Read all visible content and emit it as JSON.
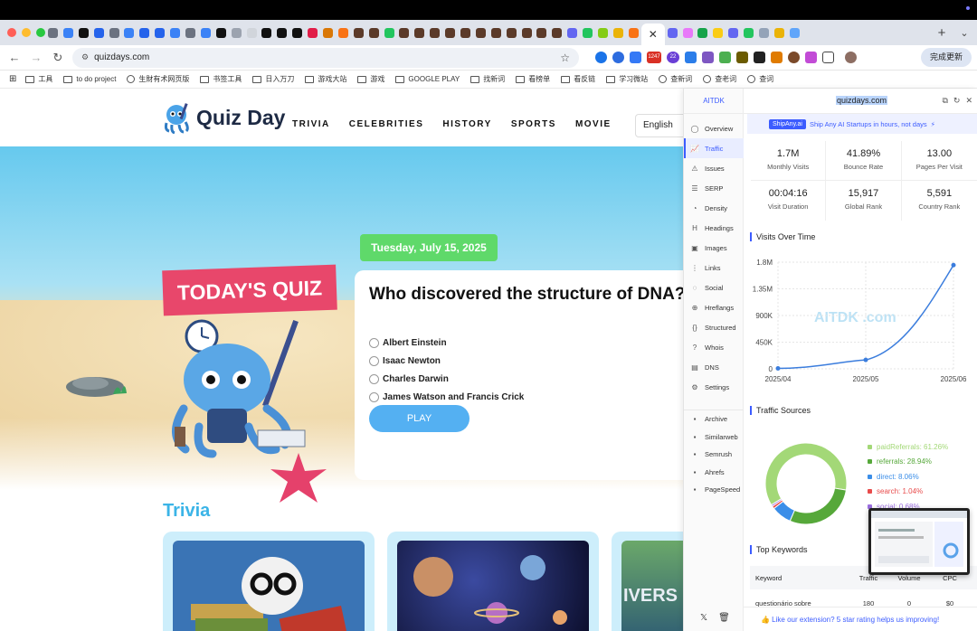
{
  "browser": {
    "url": "quizdays.com",
    "active_tab_close": "✕",
    "new_tab": "+",
    "tab_menu": "⌄",
    "update_button": "完成更新",
    "badge_1": "1247",
    "badge_2": "22",
    "bookmarks": [
      "工具",
      "to do project",
      "生財有术网页版",
      "书签工具",
      "日入万刀",
      "游戏大站",
      "游戏",
      "GOOGLE PLAY",
      "找新词",
      "看榜单",
      "看反链",
      "学习微站",
      "查新词",
      "查老词",
      "查词"
    ],
    "accent": "#1a73e8"
  },
  "site": {
    "logo_text": "Quiz Day",
    "nav": [
      "TRIVIA",
      "CELEBRITIES",
      "HISTORY",
      "SPORTS",
      "MOVIE"
    ],
    "language": "English",
    "date_badge": "Tuesday, July 15, 2025",
    "todays_quiz": "TODAY'S QUIZ",
    "question": "Who discovered the structure of DNA?",
    "options": [
      "Albert Einstein",
      "Isaac Newton",
      "Charles Darwin",
      "James Watson and Francis Crick"
    ],
    "play_label": "PLAY",
    "trivia_title": "Trivia",
    "card3_text": "IVERS"
  },
  "extension": {
    "brand": "AITDK",
    "domain": "quizdays.com",
    "promo_badge": "ShipAny.ai",
    "promo_text": "Ship Any AI Startups in hours, not days",
    "menu": [
      {
        "label": "Overview",
        "icon": "◯"
      },
      {
        "label": "Traffic",
        "icon": "📈"
      },
      {
        "label": "Issues",
        "icon": "⚠"
      },
      {
        "label": "SERP",
        "icon": "☰"
      },
      {
        "label": "Density",
        "icon": "◔"
      },
      {
        "label": "Headings",
        "icon": "H"
      },
      {
        "label": "Images",
        "icon": "▣"
      },
      {
        "label": "Links",
        "icon": "⋮"
      },
      {
        "label": "Social",
        "icon": "◌"
      },
      {
        "label": "Hreflangs",
        "icon": "⊕"
      },
      {
        "label": "Structured",
        "icon": "{}"
      },
      {
        "label": "Whois",
        "icon": "?"
      },
      {
        "label": "DNS",
        "icon": "▤"
      },
      {
        "label": "Settings",
        "icon": "⚙"
      }
    ],
    "links": [
      "Archive",
      "Similarweb",
      "Semrush",
      "Ahrefs",
      "PageSpeed"
    ],
    "stats": [
      {
        "value": "1.7M",
        "label": "Monthly Visits"
      },
      {
        "value": "41.89%",
        "label": "Bounce Rate"
      },
      {
        "value": "13.00",
        "label": "Pages Per Visit"
      },
      {
        "value": "00:04:16",
        "label": "Visit Duration"
      },
      {
        "value": "15,917",
        "label": "Global Rank"
      },
      {
        "value": "5,591",
        "label": "Country Rank"
      }
    ],
    "visits_title": "Visits Over Time",
    "watermark": "AITDK .com",
    "sources_title": "Traffic Sources",
    "keywords_title": "Top Keywords",
    "keyword_headers": [
      "Keyword",
      "Traffic",
      "Volume",
      "CPC"
    ],
    "keyword_rows": [
      {
        "keyword": "questionário sobre",
        "traffic": "180",
        "volume": "0",
        "cpc": "$0"
      }
    ],
    "footer": "👍 Like our extension? 5 star rating helps us improving!",
    "social": [
      "𝕏",
      "🗑"
    ]
  },
  "chart_data": [
    {
      "type": "line",
      "title": "Visits Over Time",
      "categories": [
        "2025/04",
        "2025/05",
        "2025/06"
      ],
      "values": [
        8000,
        150000,
        1750000
      ],
      "y_ticks": [
        "0",
        "450K",
        "900K",
        "1.35M",
        "1.8M"
      ],
      "ylim": [
        0,
        1800000
      ],
      "grid": true,
      "color": "#3b7ddd"
    },
    {
      "type": "pie",
      "title": "Traffic Sources",
      "labels": [
        "paidReferrals: 61.26%",
        "referrals: 28.94%",
        "direct: 8.06%",
        "search: 1.04%",
        "social: 0.68%"
      ],
      "values": [
        61.26,
        28.94,
        8.06,
        1.04,
        0.68
      ],
      "colors": [
        "#a3d877",
        "#56a83a",
        "#3b8ee8",
        "#e84b4b",
        "#9c6fe0"
      ]
    }
  ]
}
